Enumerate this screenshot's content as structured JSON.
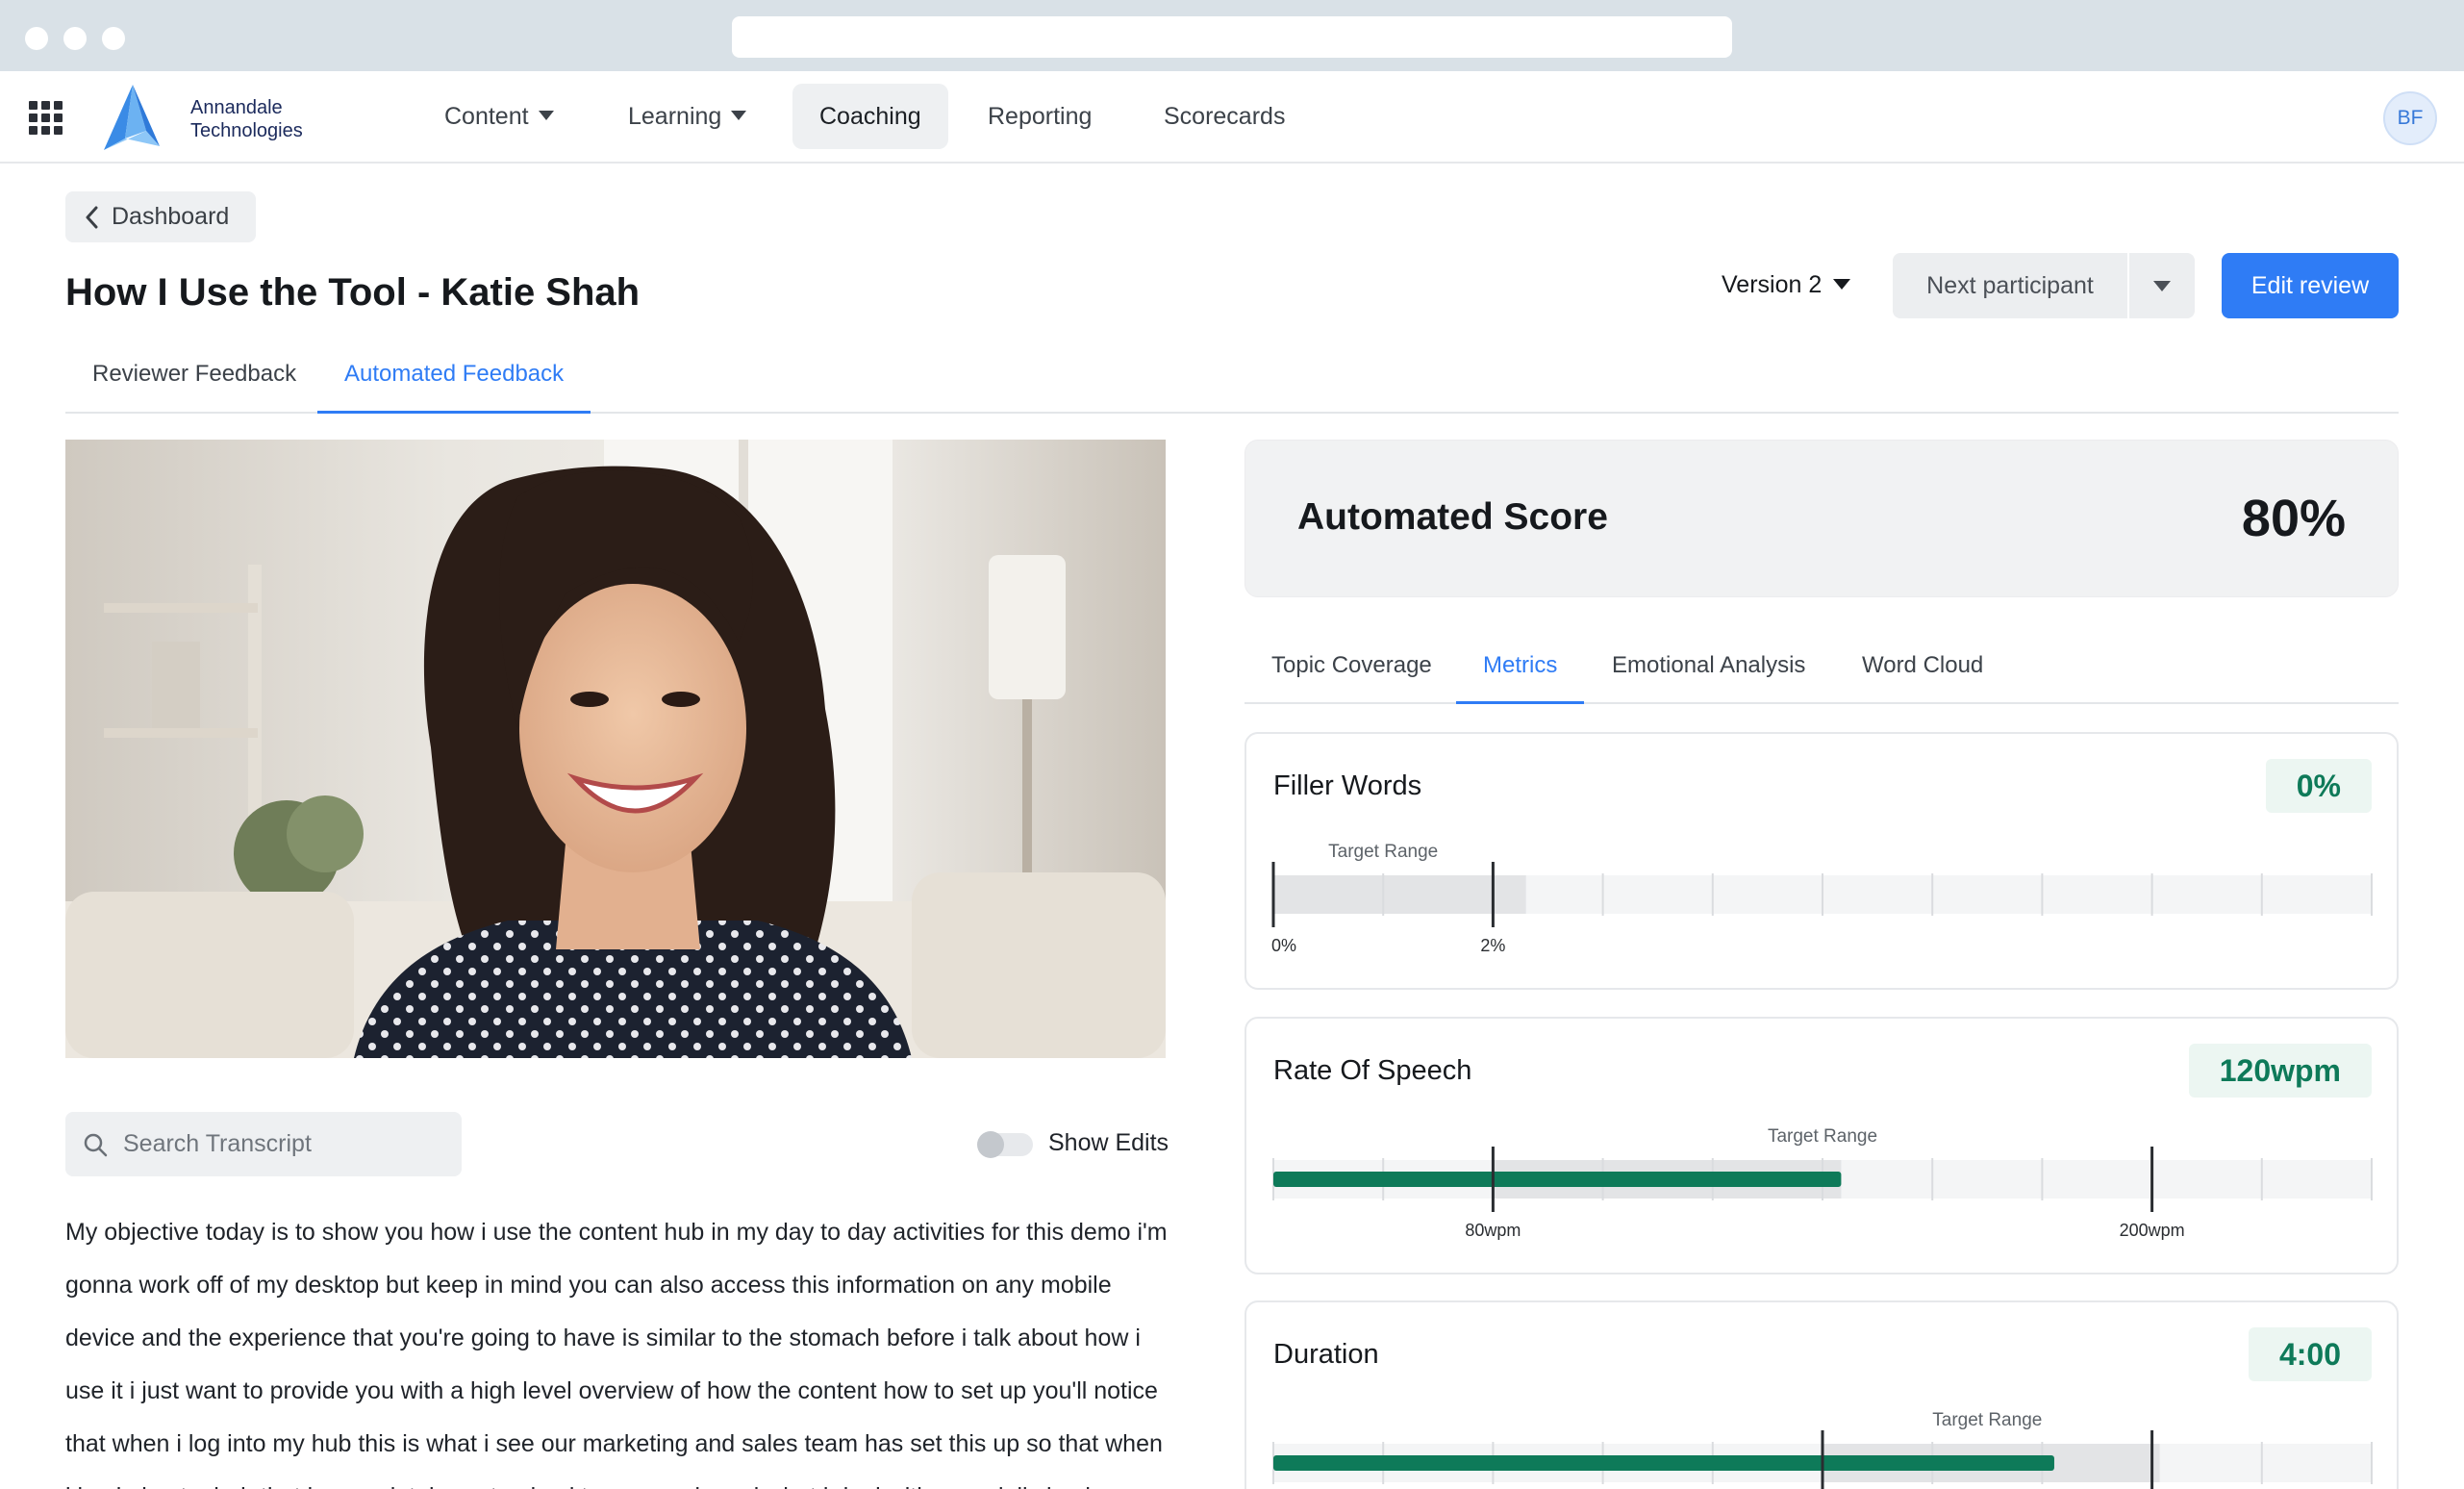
{
  "nav": {
    "logo_line1": "Annandale",
    "logo_line2": "Technologies",
    "items": [
      {
        "label": "Content",
        "has_caret": true
      },
      {
        "label": "Learning",
        "has_caret": true
      },
      {
        "label": "Coaching",
        "active": true
      },
      {
        "label": "Reporting"
      },
      {
        "label": "Scorecards"
      }
    ],
    "avatar_initials": "BF"
  },
  "header": {
    "back_label": "Dashboard",
    "title": "How I Use the Tool - Katie Shah",
    "version_label": "Version 2",
    "next_label": "Next participant",
    "edit_label": "Edit review"
  },
  "main_tabs": [
    {
      "label": "Reviewer Feedback"
    },
    {
      "label": "Automated Feedback",
      "active": true
    }
  ],
  "transcript": {
    "search_placeholder": "Search Transcript",
    "toggle_label": "Show Edits",
    "toggle_on": false,
    "text": "My objective today is to show you how i use the content hub in my day to day activities for this demo i'm gonna work off of my desktop but keep in mind you can also access this information on any mobile device and the experience that you're going to have is similar to the stomach before i talk about how i use it i just want to provide you with a high level overview of how the content how to set up you'll notice that when i log into my hub this is what i see our marketing and sales team has set this up so that when i log in i get a hub that is completely customized to my needs and what i deal with on a daily basis"
  },
  "score": {
    "label": "Automated Score",
    "value": "80%"
  },
  "sub_tabs": [
    {
      "label": "Topic Coverage"
    },
    {
      "label": "Metrics",
      "active": true
    },
    {
      "label": "Emotional Analysis"
    },
    {
      "label": "Word Cloud"
    }
  ],
  "metrics": [
    {
      "title": "Filler Words",
      "value": "0%",
      "target_label": "Target Range",
      "range_min_label": "0%",
      "range_max_label": "2%",
      "fill_fraction": 0,
      "range_start_fraction": 0.0,
      "range_end_fraction": 0.2,
      "shaded_end_fraction": 0.23
    },
    {
      "title": "Rate Of Speech",
      "value": "120wpm",
      "target_label": "Target Range",
      "range_min_label": "80wpm",
      "range_max_label": "200wpm",
      "fill_fraction": 0.517,
      "range_start_fraction": 0.2,
      "range_end_fraction": 0.8,
      "shaded_end_fraction": 0.517
    },
    {
      "title": "Duration",
      "value": "4:00",
      "target_label": "Target Range",
      "range_min_label": "",
      "range_max_label": "",
      "fill_fraction": 0.711,
      "range_start_fraction": 0.5,
      "range_end_fraction": 0.8,
      "shaded_end_fraction": 0.807
    }
  ],
  "colors": {
    "accent": "#2f7cf5",
    "success": "#0e7a59",
    "success_bg": "#ecf6f2"
  }
}
